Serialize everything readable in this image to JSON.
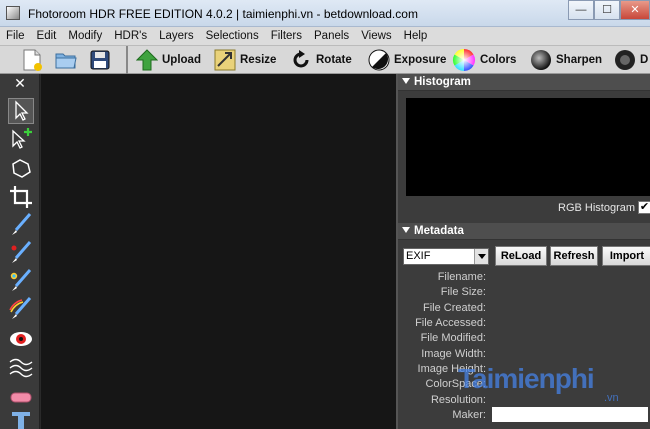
{
  "window": {
    "title": "Fhotoroom HDR FREE EDITION 4.0.2 | taimienphi.vn - betdownload.com"
  },
  "menu": [
    "File",
    "Edit",
    "Modify",
    "HDR's",
    "Layers",
    "Selections",
    "Filters",
    "Panels",
    "Views",
    "Help"
  ],
  "toolbar": {
    "upload": "Upload",
    "resize": "Resize",
    "rotate": "Rotate",
    "exposure": "Exposure",
    "colors": "Colors",
    "sharpen": "Sharpen",
    "clipped": "D"
  },
  "tools": [
    "close-panel",
    "select",
    "add-select",
    "lasso",
    "crop",
    "brush-blue",
    "brush-red",
    "brush-color",
    "brush-rainbow",
    "red-eye",
    "wave",
    "eraser",
    "text",
    "stamp"
  ],
  "histogram": {
    "title": "Histogram",
    "rgb_label": "RGB Histogram",
    "checkbox": "✔"
  },
  "metadata": {
    "title": "Metadata",
    "format": "EXIF",
    "reload": "ReLoad",
    "refresh": "Refresh",
    "import": "Import",
    "fields": [
      "Filename:",
      "File Size:",
      "File Created:",
      "File Accessed:",
      "File Modified:",
      "Image Width:",
      "Image Height:",
      "ColorSpace:",
      "Resolution:",
      "Maker:"
    ]
  },
  "watermark": {
    "main": "Taimienphi",
    "sub": ".vn"
  },
  "close_symbol": "✕"
}
